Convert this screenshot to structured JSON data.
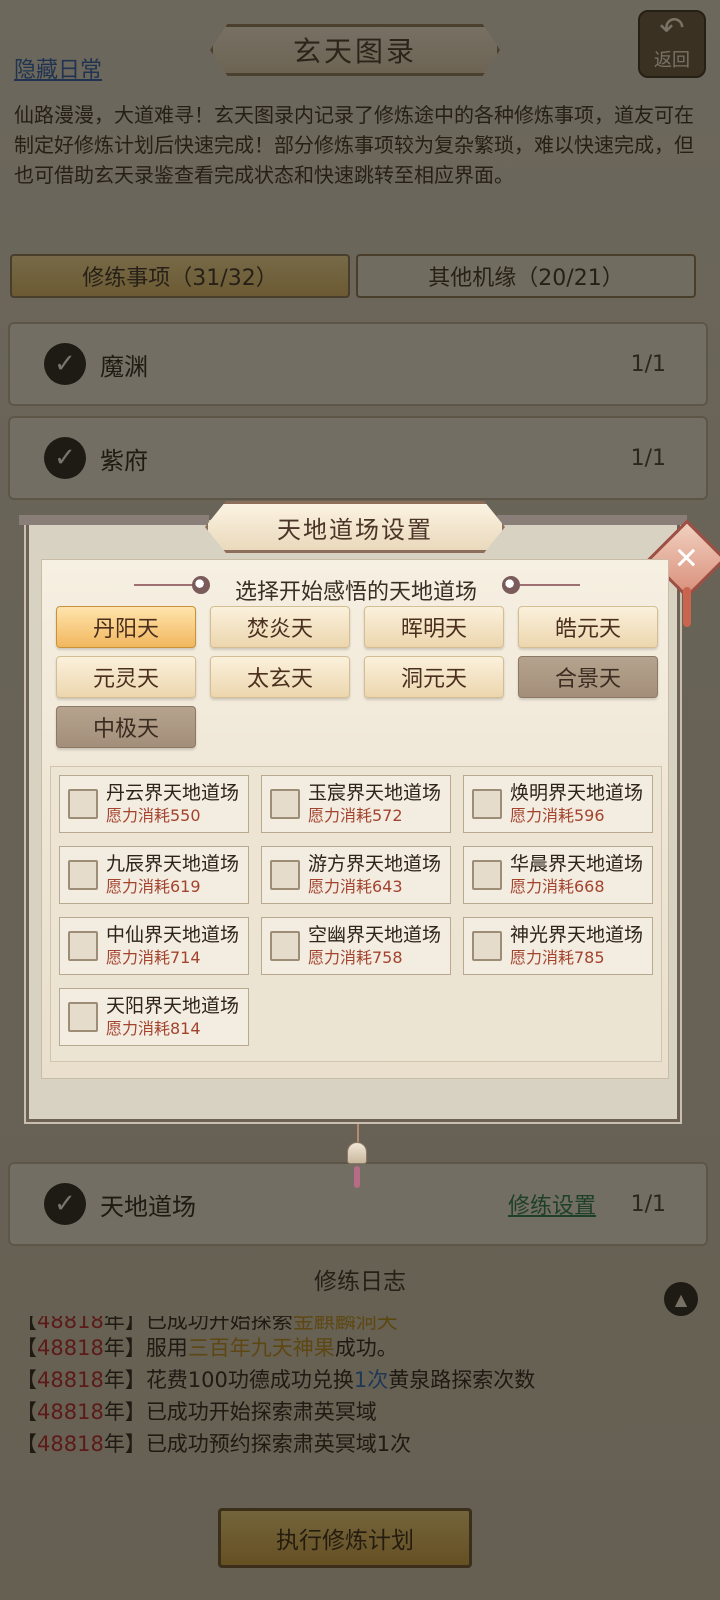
{
  "header": {
    "title": "玄天图录",
    "hidden_daily_link": "隐藏日常",
    "back_label": "返回"
  },
  "intro_text": "仙路漫漫，大道难寻！玄天图录内记录了修炼途中的各种修炼事项，道友可在制定好修炼计划后快速完成！部分修炼事项较为复杂繁琐，难以快速完成，但也可借助玄天录鉴查看完成状态和快速跳转至相应界面。",
  "tabs": [
    {
      "label": "修练事项（31/32）",
      "active": true
    },
    {
      "label": "其他机缘（20/21）",
      "active": false
    }
  ],
  "tasks": [
    {
      "name": "魔渊",
      "count": "1/1"
    },
    {
      "name": "紫府",
      "count": "1/1"
    },
    {
      "name": "天地道场",
      "count": "1/1",
      "link": "修练设置"
    }
  ],
  "log": {
    "title": "修练日志",
    "lines": [
      {
        "year": "48818",
        "parts": [
          {
            "t": "已成功开始探索"
          },
          {
            "t": "金麒麟洞天",
            "c": "hl"
          }
        ]
      },
      {
        "year": "48818",
        "parts": [
          {
            "t": "服用"
          },
          {
            "t": "三百年九天神果",
            "c": "hl"
          },
          {
            "t": "成功。"
          }
        ]
      },
      {
        "year": "48818",
        "parts": [
          {
            "t": "花费100功德成功兑换"
          },
          {
            "t": "1次",
            "c": "blue"
          },
          {
            "t": "黄泉路探索次数"
          }
        ]
      },
      {
        "year": "48818",
        "parts": [
          {
            "t": "已成功开始探索肃英冥域"
          }
        ]
      },
      {
        "year": "48818",
        "parts": [
          {
            "t": "已成功预约探索肃英冥域1次"
          }
        ]
      }
    ]
  },
  "execute_button": "执行修炼计划",
  "modal": {
    "title": "天地道场设置",
    "subtitle": "选择开始感悟的天地道场",
    "realms": [
      {
        "label": "丹阳天",
        "state": "selected"
      },
      {
        "label": "焚炎天",
        "state": "normal"
      },
      {
        "label": "晖明天",
        "state": "normal"
      },
      {
        "label": "皓元天",
        "state": "normal"
      },
      {
        "label": "元灵天",
        "state": "normal"
      },
      {
        "label": "太玄天",
        "state": "normal"
      },
      {
        "label": "洞元天",
        "state": "normal"
      },
      {
        "label": "合景天",
        "state": "locked"
      },
      {
        "label": "中极天",
        "state": "locked"
      }
    ],
    "fields": [
      {
        "name": "丹云界天地道场",
        "cost": "愿力消耗550"
      },
      {
        "name": "玉宸界天地道场",
        "cost": "愿力消耗572"
      },
      {
        "name": "焕明界天地道场",
        "cost": "愿力消耗596"
      },
      {
        "name": "九辰界天地道场",
        "cost": "愿力消耗619"
      },
      {
        "name": "游方界天地道场",
        "cost": "愿力消耗643"
      },
      {
        "name": "华晨界天地道场",
        "cost": "愿力消耗668"
      },
      {
        "name": "中仙界天地道场",
        "cost": "愿力消耗714"
      },
      {
        "name": "空幽界天地道场",
        "cost": "愿力消耗758"
      },
      {
        "name": "神光界天地道场",
        "cost": "愿力消耗785"
      },
      {
        "name": "天阳界天地道场",
        "cost": "愿力消耗814"
      }
    ]
  },
  "icons": {
    "check": "check-icon",
    "close": "close-icon",
    "back": "back-arrow-icon",
    "collapse": "chevron-up-icon"
  }
}
